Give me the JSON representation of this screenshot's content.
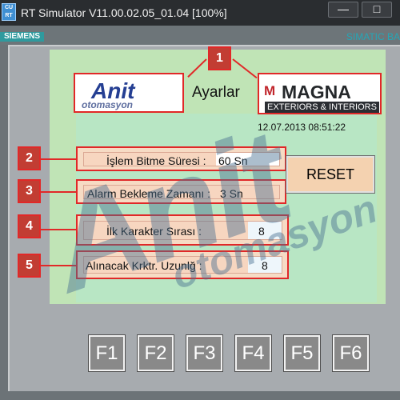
{
  "titlebar": {
    "app_icon_text": "CU RT",
    "title": "RT Simulator V11.00.02.05_01.04 [100%]",
    "minimize_icon": "—",
    "maximize_icon": "□"
  },
  "brand": {
    "siemens": "SIEMENS",
    "simatic": "SIMATIC BA"
  },
  "screen": {
    "title": "Ayarlar",
    "datetime": "12.07.2013 08:51:22",
    "anit_logo_text": "Anit",
    "anit_logo_sub": "otomasyon",
    "magna_mark": "M",
    "magna_name": "MAGNA",
    "magna_sub": "EXTERIORS & INTERIORS",
    "watermark": "Anit",
    "watermark_sub": "otomasyon",
    "callouts": [
      "1",
      "2",
      "3",
      "4",
      "5"
    ],
    "fields": [
      {
        "label": "İşlem Bitme Süresi :",
        "value": "60 Sn"
      },
      {
        "label": "Alarm Bekleme Zamanı :",
        "value": "3 Sn"
      },
      {
        "label": "İlk Karakter Sırası   :",
        "value": "8"
      },
      {
        "label": "Alınacak Krktr. Uzunlğ :",
        "value": "8"
      }
    ],
    "reset_label": "RESET"
  },
  "function_keys": [
    "F1",
    "F2",
    "F3",
    "F4",
    "F5",
    "F6"
  ],
  "colors": {
    "callout_red": "#e12828",
    "panel_green": "#b8e6c4",
    "field_bg": "#f6dbc4"
  }
}
